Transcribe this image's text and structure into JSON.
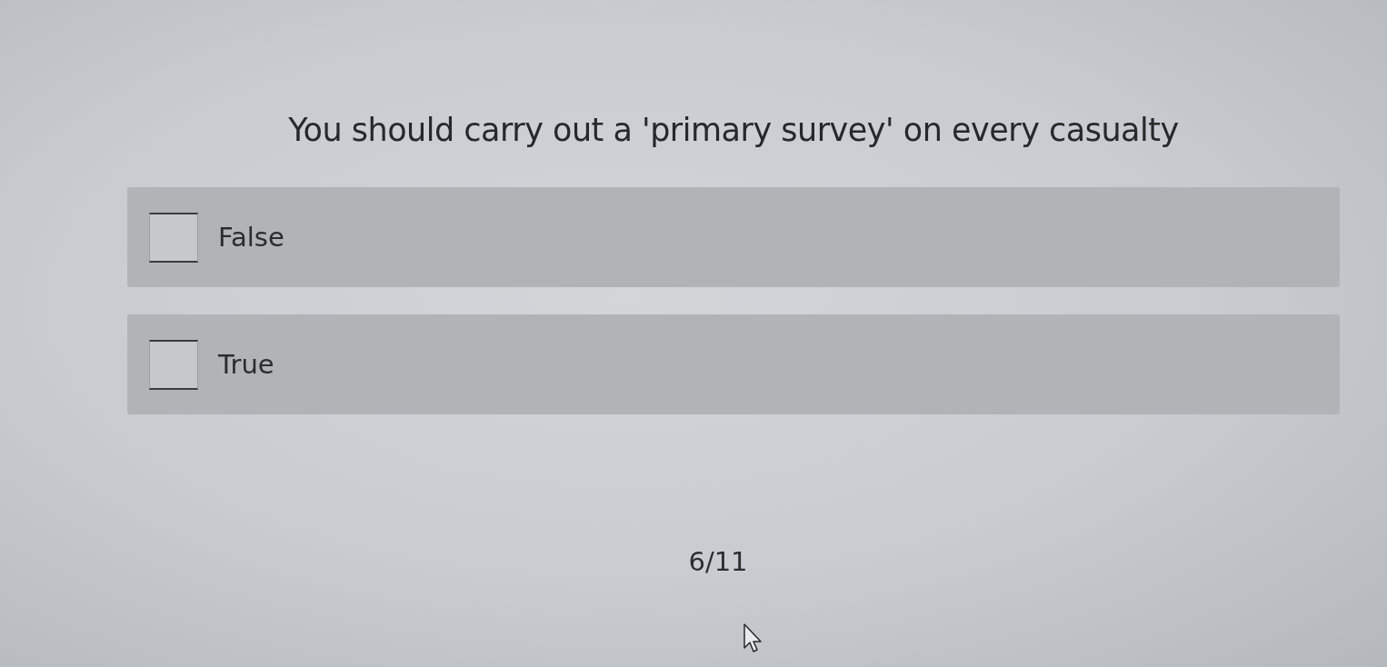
{
  "question": {
    "text": "You should carry out a 'primary survey' on every casualty"
  },
  "options": [
    {
      "label": "False",
      "checked": false
    },
    {
      "label": "True",
      "checked": false
    }
  ],
  "progress": {
    "text": "6/11"
  }
}
